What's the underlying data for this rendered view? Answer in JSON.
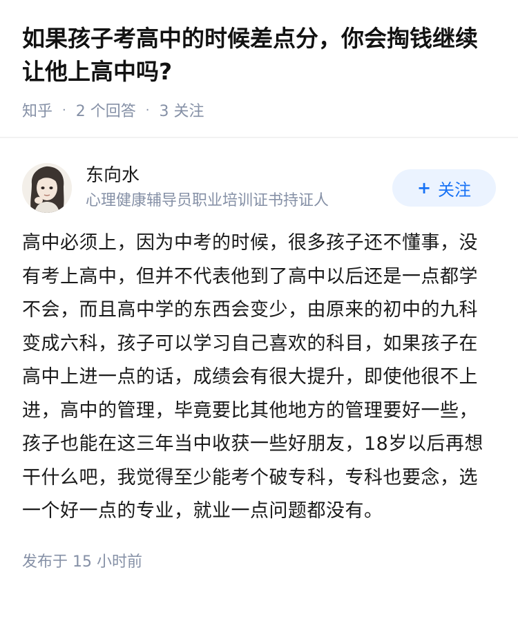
{
  "question": {
    "title": "如果孩子考高中的时候差点分，你会掏钱继续让他上高中吗?",
    "source": "知乎",
    "answers": "2 个回答",
    "follows": "3 关注"
  },
  "author": {
    "name": "东向水",
    "bio": "心理健康辅导员职业培训证书持证人",
    "follow_label": "关注",
    "follow_icon": "plus-icon"
  },
  "answer": {
    "text": "高中必须上，因为中考的时候，很多孩子还不懂事，没有考上高中，但并不代表他到了高中以后还是一点都学不会，而且高中学的东西会变少，由原来的初中的九科变成六科，孩子可以学习自己喜欢的科目，如果孩子在高中上进一点的话，成绩会有很大提升，即使他很不上进，高中的管理，毕竟要比其他地方的管理要好一些，孩子也能在这三年当中收获一些好朋友，18岁以后再想干什么吧，我觉得至少能考个破专科，专科也要念，选一个好一点的专业，就业一点问题都没有。",
    "published": "发布于 15 小时前"
  },
  "colors": {
    "accent": "#1772f6",
    "follow_bg": "#ebf3ff",
    "meta": "#8590a6"
  }
}
